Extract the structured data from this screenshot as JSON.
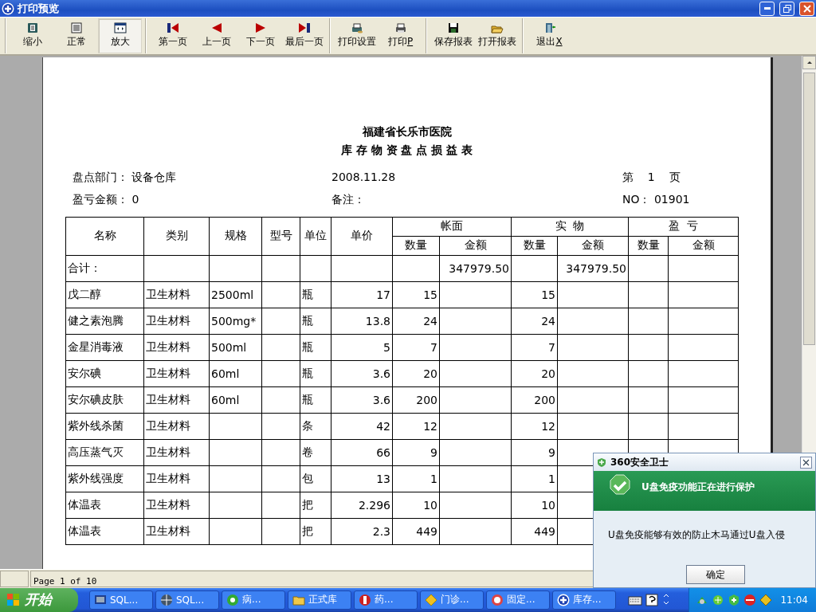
{
  "window": {
    "title": "打印预览"
  },
  "toolbar": {
    "groups": [
      [
        {
          "label": "缩小",
          "selected": false
        },
        {
          "label": "正常",
          "selected": false
        },
        {
          "label": "放大",
          "selected": true
        }
      ],
      [
        {
          "label": "第一页",
          "selected": false
        },
        {
          "label": "上一页",
          "selected": false
        },
        {
          "label": "下一页",
          "selected": false
        },
        {
          "label": "最后一页",
          "selected": false
        }
      ],
      [
        {
          "label": "打印设置",
          "selected": false
        },
        {
          "label": "打印",
          "accel": "P",
          "selected": false
        }
      ],
      [
        {
          "label": "保存报表",
          "selected": false
        },
        {
          "label": "打开报表",
          "selected": false
        }
      ],
      [
        {
          "label": "退出",
          "accel": "X",
          "selected": false
        }
      ]
    ]
  },
  "report": {
    "title": "福建省长乐市医院",
    "subtitle": "库 存 物 资 盘 点 损 益 表",
    "info": [
      [
        {
          "label": "盘点部门：",
          "value": "设备仓库"
        },
        {
          "value": "2008.11.28"
        },
        {
          "value": "第    1    页"
        }
      ],
      [
        {
          "label": "盈亏金额：",
          "value": "0"
        },
        {
          "label": "备注："
        },
        {
          "label": "NO：",
          "value": "01901"
        }
      ]
    ],
    "columns": [
      "名称",
      "类别",
      "规格",
      "型号",
      "单位",
      "单价"
    ],
    "groups": [
      {
        "label": "帐面",
        "sub": [
          "数量",
          "金额"
        ]
      },
      {
        "label": "实  物",
        "sub": [
          "数量",
          "金额"
        ]
      },
      {
        "label": "盈  亏",
        "sub": [
          "数量",
          "金额"
        ]
      }
    ],
    "rows": [
      [
        "合计：",
        "",
        "",
        "",
        "",
        "",
        "",
        "347979.50",
        "",
        "347979.50",
        "",
        ""
      ],
      [
        "戊二醇",
        "卫生材料",
        "2500ml",
        "",
        "瓶",
        "17",
        "15",
        "",
        "15",
        "",
        "",
        ""
      ],
      [
        "健之素泡腾",
        "卫生材料",
        "500mg*",
        "",
        "瓶",
        "13.8",
        "24",
        "",
        "24",
        "",
        "",
        ""
      ],
      [
        "金星消毒液",
        "卫生材料",
        "500ml",
        "",
        "瓶",
        "5",
        "7",
        "",
        "7",
        "",
        "",
        ""
      ],
      [
        "安尔碘",
        "卫生材料",
        "60ml",
        "",
        "瓶",
        "3.6",
        "20",
        "",
        "20",
        "",
        "",
        ""
      ],
      [
        "安尔碘皮肤",
        "卫生材料",
        "60ml",
        "",
        "瓶",
        "3.6",
        "200",
        "",
        "200",
        "",
        "",
        ""
      ],
      [
        "紫外线杀菌",
        "卫生材料",
        "",
        "",
        "条",
        "42",
        "12",
        "",
        "12",
        "",
        "",
        ""
      ],
      [
        "高压蒸气灭",
        "卫生材料",
        "",
        "",
        "卷",
        "66",
        "9",
        "",
        "9",
        "",
        "",
        ""
      ],
      [
        "紫外线强度",
        "卫生材料",
        "",
        "",
        "包",
        "13",
        "1",
        "",
        "1",
        "",
        "",
        ""
      ],
      [
        "体温表",
        "卫生材料",
        "",
        "",
        "把",
        "2.296",
        "10",
        "",
        "10",
        "",
        "",
        ""
      ],
      [
        "体温表",
        "卫生材料",
        "",
        "",
        "把",
        "2.3",
        "449",
        "",
        "449",
        "",
        "",
        ""
      ]
    ]
  },
  "status_bar": {
    "text": "Page 1 of 10"
  },
  "popup": {
    "title": "360安全卫士",
    "headline": "U盘免疫功能正在进行保护",
    "message": "U盘免疫能够有效的防止木马通过U盘入侵",
    "button": "确定"
  },
  "taskbar": {
    "start": "开始",
    "tasks": [
      {
        "label": "SQL..."
      },
      {
        "label": "SQL..."
      },
      {
        "label": "病..."
      },
      {
        "label": "正式库"
      },
      {
        "label": "药..."
      },
      {
        "label": "门诊..."
      },
      {
        "label": "固定..."
      },
      {
        "label": "库存..."
      }
    ],
    "clock": "11:04"
  }
}
